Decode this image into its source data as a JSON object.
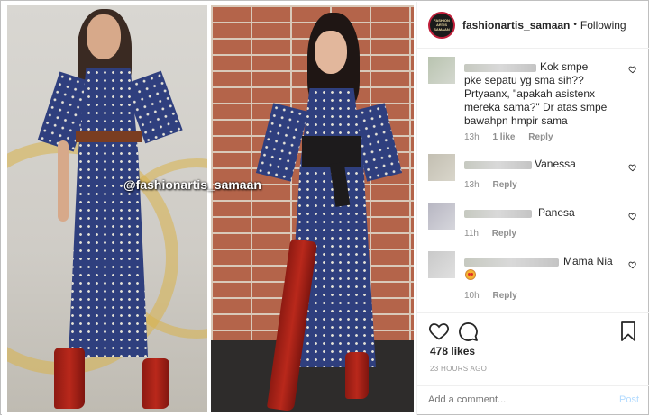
{
  "photos": {
    "watermark": "@fashionartis_samaan"
  },
  "header": {
    "avatar_text": "FASHION ARTIS SAMAAN",
    "username": "fashionartis_samaan",
    "separator": "•",
    "follow_status": "Following"
  },
  "comments": [
    {
      "username_blurred": "ray_tembaangiemah",
      "text_line1": "Kok smpe",
      "text_rest": "pke sepatu yg sma sih?? Prtyaanx, \"apakah asistenx mereka sama?\" Dr atas smpe bawahpn hmpir sama",
      "time": "13h",
      "likes": "1 like",
      "reply": "Reply"
    },
    {
      "text": "Vanessa",
      "time": "13h",
      "reply": "Reply"
    },
    {
      "text": "Panesa",
      "time": "11h",
      "reply": "Reply"
    },
    {
      "text": "Mama Nia",
      "emoji": "star-struck",
      "time": "10h",
      "reply": "Reply"
    }
  ],
  "actions": {
    "likes": "478 likes",
    "timestamp": "23 HOURS AGO",
    "comment_placeholder": "Add a comment...",
    "post_label": "Post"
  }
}
